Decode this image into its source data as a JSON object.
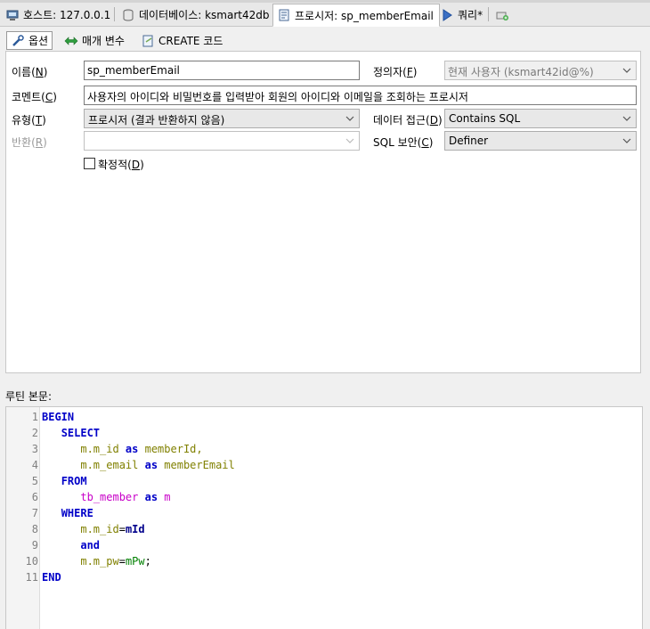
{
  "top_tabs": [
    {
      "label": "호스트: 127.0.0.1",
      "icon": "host-icon"
    },
    {
      "label": "데이터베이스: ksmart42db",
      "icon": "database-icon"
    },
    {
      "label": "프로시저: sp_memberEmail",
      "icon": "procedure-icon"
    },
    {
      "label": "쿼리*",
      "icon": "query-play-icon"
    },
    {
      "label": "",
      "icon": "new-tab-icon"
    }
  ],
  "sub_tabs": [
    {
      "label": "옵션",
      "icon": "wrench-icon"
    },
    {
      "label": "매개 변수",
      "icon": "arrows-icon"
    },
    {
      "label": "CREATE 코드",
      "icon": "code-icon"
    }
  ],
  "form": {
    "name_label": "이름(",
    "name_key": "N",
    "name_value": "sp_memberEmail",
    "definer_label": "정의자(",
    "definer_key": "F",
    "definer_value": "현재 사용자 (ksmart42id@%)",
    "comment_label": "코멘트(",
    "comment_key": "C",
    "comment_value": "사용자의 아이디와 비밀번호를 입력받아 회원의 아이디와 이메일을 조회하는 프로시저",
    "type_label": "유형(",
    "type_key": "T",
    "type_value": "프로시저 (결과 반환하지 않음)",
    "data_access_label": "데이터 접근(",
    "data_access_key": "D",
    "data_access_value": "Contains SQL",
    "returns_label": "반환(",
    "returns_key": "R",
    "returns_value": "",
    "sql_security_label": "SQL 보안(",
    "sql_security_key": "C",
    "sql_security_value": "Definer",
    "deterministic_label": "확정적(",
    "deterministic_key": "D",
    "deterministic_checked": false
  },
  "routine_body_label": "루틴 본문:",
  "code_lines": [
    {
      "n": "1",
      "tokens": [
        {
          "t": "BEGIN",
          "c": "kw"
        }
      ]
    },
    {
      "n": "2",
      "tokens": [
        {
          "t": "   ",
          "c": "op"
        },
        {
          "t": "SELECT",
          "c": "kw"
        }
      ]
    },
    {
      "n": "3",
      "tokens": [
        {
          "t": "      m.m_id ",
          "c": "col"
        },
        {
          "t": "as",
          "c": "kw"
        },
        {
          "t": " memberId,",
          "c": "col"
        }
      ]
    },
    {
      "n": "4",
      "tokens": [
        {
          "t": "      m.m_email ",
          "c": "col"
        },
        {
          "t": "as",
          "c": "kw"
        },
        {
          "t": " memberEmail",
          "c": "col"
        }
      ]
    },
    {
      "n": "5",
      "tokens": [
        {
          "t": "   ",
          "c": "op"
        },
        {
          "t": "FROM",
          "c": "kw"
        }
      ]
    },
    {
      "n": "6",
      "tokens": [
        {
          "t": "      tb_member ",
          "c": "tbl"
        },
        {
          "t": "as",
          "c": "kw"
        },
        {
          "t": " m",
          "c": "tbl"
        }
      ]
    },
    {
      "n": "7",
      "tokens": [
        {
          "t": "   ",
          "c": "op"
        },
        {
          "t": "WHERE",
          "c": "kw"
        }
      ]
    },
    {
      "n": "8",
      "tokens": [
        {
          "t": "      m.m_id",
          "c": "col"
        },
        {
          "t": "=",
          "c": "op"
        },
        {
          "t": "mId",
          "c": "var"
        }
      ]
    },
    {
      "n": "9",
      "tokens": [
        {
          "t": "      ",
          "c": "op"
        },
        {
          "t": "and",
          "c": "kw"
        }
      ]
    },
    {
      "n": "10",
      "tokens": [
        {
          "t": "      m.m_pw",
          "c": "col"
        },
        {
          "t": "=",
          "c": "op"
        },
        {
          "t": "mPw",
          "c": "rvar"
        },
        {
          "t": ";",
          "c": "op"
        }
      ]
    },
    {
      "n": "11",
      "tokens": [
        {
          "t": "END",
          "c": "kw"
        }
      ]
    }
  ]
}
